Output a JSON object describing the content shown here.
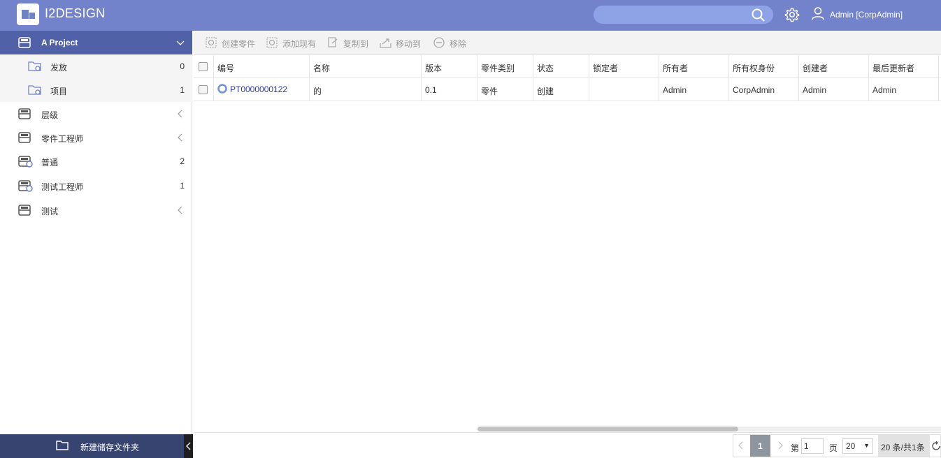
{
  "app": {
    "title": "I2DESIGN"
  },
  "header": {
    "user_name": "Admin [CorpAdmin]",
    "search_placeholder": ""
  },
  "sidebar": {
    "items": [
      {
        "label": "A Project",
        "count": "",
        "active": true
      },
      {
        "label": "发放",
        "count": "0"
      },
      {
        "label": "项目",
        "count": "1"
      },
      {
        "label": "层级",
        "count": ""
      },
      {
        "label": "零件工程师",
        "count": ""
      },
      {
        "label": "普通",
        "count": "2"
      },
      {
        "label": "测试工程师",
        "count": "1"
      },
      {
        "label": "测试",
        "count": ""
      }
    ],
    "footer_label": "新建储存文件夹"
  },
  "toolbar": {
    "create_part": "创建零件",
    "add_existing": "添加现有",
    "copy_to": "复制到",
    "move_to": "移动到",
    "remove": "移除"
  },
  "table": {
    "columns": [
      "编号",
      "名称",
      "版本",
      "零件类别",
      "状态",
      "锁定者",
      "所有者",
      "所有权身份",
      "创建者",
      "最后更新者"
    ],
    "rows": [
      [
        "PT0000000122",
        "的",
        "0.1",
        "零件",
        "创建",
        "",
        "Admin",
        "CorpAdmin",
        "Admin",
        "Admin"
      ]
    ]
  },
  "pager": {
    "current_page": "1",
    "page_prefix": "第",
    "page_input": "1",
    "page_suffix": "页",
    "page_size": "20",
    "total": "20 条/共1条"
  },
  "colors": {
    "header": "#7383cb",
    "active": "#5161a8",
    "footer": "#37446f"
  }
}
